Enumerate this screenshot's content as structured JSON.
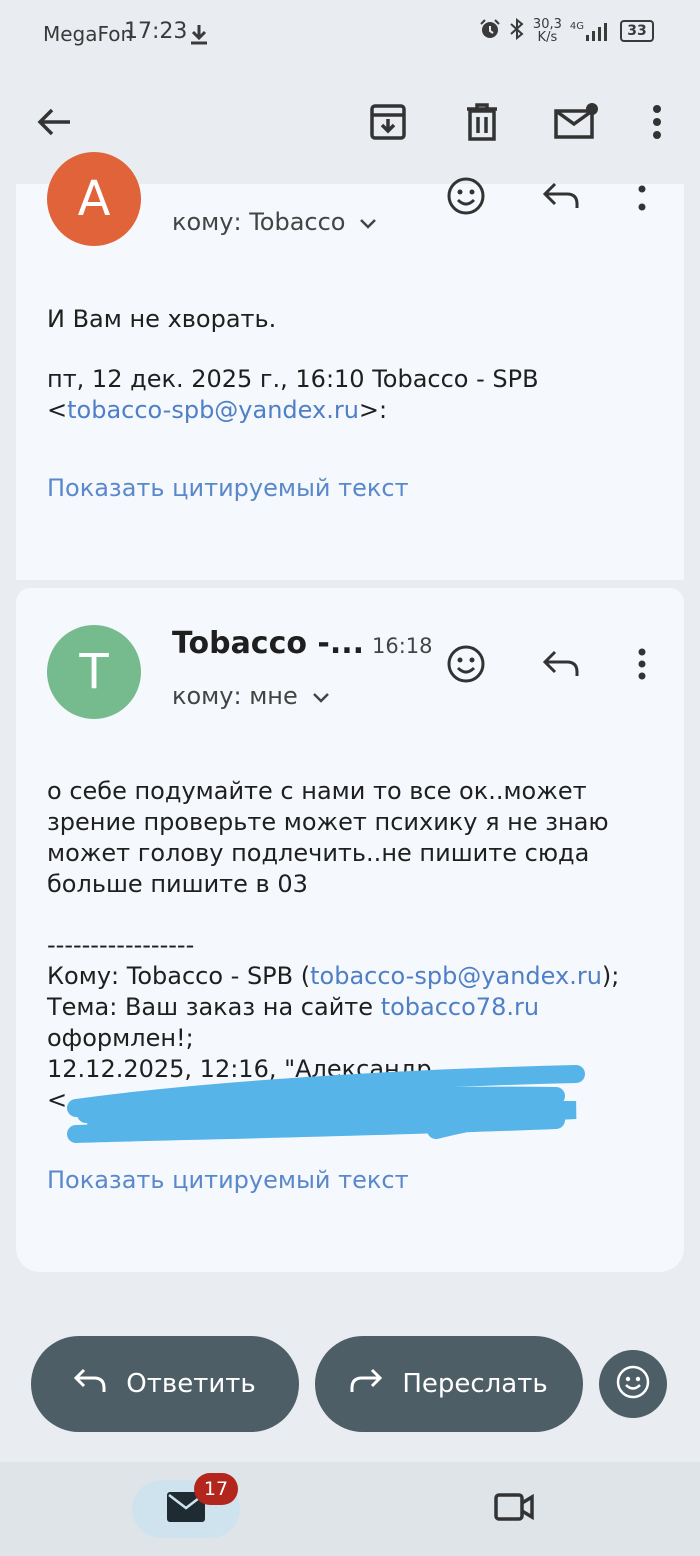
{
  "status": {
    "carrier": "MegaFon",
    "time": "17:23",
    "speed_value": "30,3",
    "speed_unit": "K/s",
    "network": "4G",
    "battery": "33"
  },
  "message1": {
    "avatar_letter": "А",
    "avatar_color": "#e0633a",
    "to_line": "кому: Tobacco",
    "body_line1": "И Вам не хворать.",
    "quote_intro": "пт, 12 дек. 2025 г., 16:10 Tobacco - SPB",
    "quote_email_open": "<",
    "quote_email": "tobacco-spb@yandex.ru",
    "quote_email_close": ">:",
    "show_quoted": "Показать цитируемый текст"
  },
  "message2": {
    "avatar_letter": "T",
    "avatar_color": "#76bb8e",
    "sender": "Tobacco -...",
    "time": "16:18",
    "to_line": "кому: мне",
    "body_lines": [
      "о себе подумайте с нами то все ок..может",
      "зрение проверьте может психику я не знаю",
      "может голову подлечить..не пишите сюда",
      "больше пишите в 03"
    ],
    "separator": "-----------------",
    "to_prefix": "Кому: Tobacco - SPB (",
    "to_email": "tobacco-spb@yandex.ru",
    "to_suffix": ");",
    "subject_prefix": "Тема: Ваш заказ на сайте ",
    "subject_link": "tobacco78.ru",
    "subject_line2": "оформлен!;",
    "date_line": "12.12.2025, 12:16, \"Александр",
    "angle_open": "<",
    "show_quoted": "Показать цитируемый текст"
  },
  "actions": {
    "reply": "Ответить",
    "forward": "Переслать"
  },
  "nav": {
    "mail_badge": "17"
  },
  "icons": [
    "back-arrow-icon",
    "archive-icon",
    "trash-icon",
    "mark-unread-icon",
    "more-vert-icon",
    "emoji-icon",
    "reply-icon",
    "forward-icon",
    "mail-icon",
    "video-icon",
    "chevron-down-icon",
    "download-icon",
    "alarm-icon",
    "bluetooth-icon",
    "signal-icon",
    "battery-icon"
  ]
}
